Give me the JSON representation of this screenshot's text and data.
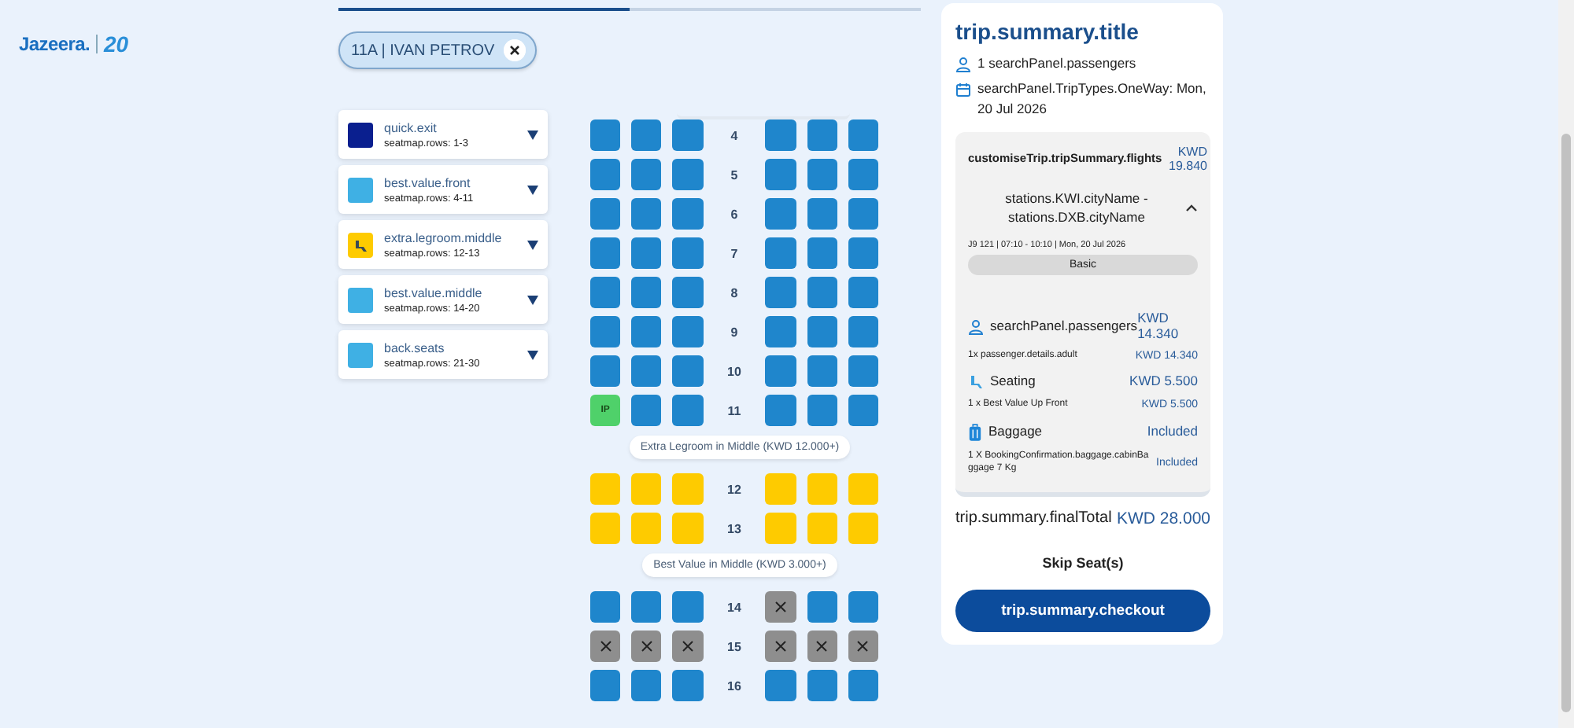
{
  "logo": {
    "brand": "Jazeera.",
    "anniversary": "20"
  },
  "tab_indicator": [
    {
      "selected": true
    },
    {
      "selected": false
    }
  ],
  "passenger_chip": {
    "label": "11A | IVAN PETROV"
  },
  "legend": [
    {
      "title": "quick.exit",
      "rows": "seatmap.rows: 1-3",
      "color": "#0a1f8f",
      "kind": "plain"
    },
    {
      "title": "best.value.front",
      "rows": "seatmap.rows: 4-11",
      "color": "#3fb0e4",
      "kind": "plain"
    },
    {
      "title": "extra.legroom.middle",
      "rows": "seatmap.rows: 12-13",
      "color": "#fecb00",
      "kind": "legroom"
    },
    {
      "title": "best.value.middle",
      "rows": "seatmap.rows: 14-20",
      "color": "#3fb0e4",
      "kind": "plain"
    },
    {
      "title": "back.seats",
      "rows": "seatmap.rows: 21-30",
      "color": "#3fb0e4",
      "kind": "plain"
    }
  ],
  "seat_map": {
    "sections": [
      {
        "rows": [
          {
            "number": "4",
            "seats": [
              {
                "kind": "available"
              },
              {
                "kind": "available"
              },
              {
                "kind": "available"
              },
              {
                "kind": "available"
              },
              {
                "kind": "available"
              },
              {
                "kind": "available"
              }
            ]
          },
          {
            "number": "5",
            "seats": [
              {
                "kind": "available"
              },
              {
                "kind": "available"
              },
              {
                "kind": "available"
              },
              {
                "kind": "available"
              },
              {
                "kind": "available"
              },
              {
                "kind": "available"
              }
            ]
          },
          {
            "number": "6",
            "seats": [
              {
                "kind": "available"
              },
              {
                "kind": "available"
              },
              {
                "kind": "available"
              },
              {
                "kind": "available"
              },
              {
                "kind": "available"
              },
              {
                "kind": "available"
              }
            ]
          },
          {
            "number": "7",
            "seats": [
              {
                "kind": "available"
              },
              {
                "kind": "available"
              },
              {
                "kind": "available"
              },
              {
                "kind": "available"
              },
              {
                "kind": "available"
              },
              {
                "kind": "available"
              }
            ]
          },
          {
            "number": "8",
            "seats": [
              {
                "kind": "available"
              },
              {
                "kind": "available"
              },
              {
                "kind": "available"
              },
              {
                "kind": "available"
              },
              {
                "kind": "available"
              },
              {
                "kind": "available"
              }
            ]
          },
          {
            "number": "9",
            "seats": [
              {
                "kind": "available"
              },
              {
                "kind": "available"
              },
              {
                "kind": "available"
              },
              {
                "kind": "available"
              },
              {
                "kind": "available"
              },
              {
                "kind": "available"
              }
            ]
          },
          {
            "number": "10",
            "seats": [
              {
                "kind": "available"
              },
              {
                "kind": "available"
              },
              {
                "kind": "available"
              },
              {
                "kind": "available"
              },
              {
                "kind": "available"
              },
              {
                "kind": "available"
              }
            ]
          },
          {
            "number": "11",
            "seats": [
              {
                "kind": "selected",
                "label": "IP"
              },
              {
                "kind": "available"
              },
              {
                "kind": "available"
              },
              {
                "kind": "available"
              },
              {
                "kind": "available"
              },
              {
                "kind": "available"
              }
            ]
          }
        ]
      },
      {
        "label": "Extra Legroom in Middle (KWD 12.000+)",
        "rows": [
          {
            "number": "12",
            "seats": [
              {
                "kind": "extra"
              },
              {
                "kind": "extra"
              },
              {
                "kind": "extra"
              },
              {
                "kind": "extra"
              },
              {
                "kind": "extra"
              },
              {
                "kind": "extra"
              }
            ]
          },
          {
            "number": "13",
            "seats": [
              {
                "kind": "extra"
              },
              {
                "kind": "extra"
              },
              {
                "kind": "extra"
              },
              {
                "kind": "extra"
              },
              {
                "kind": "extra"
              },
              {
                "kind": "extra"
              }
            ]
          }
        ]
      },
      {
        "label": "Best Value in Middle (KWD 3.000+)",
        "rows": [
          {
            "number": "14",
            "seats": [
              {
                "kind": "available"
              },
              {
                "kind": "available"
              },
              {
                "kind": "available"
              },
              {
                "kind": "occupied"
              },
              {
                "kind": "available"
              },
              {
                "kind": "available"
              }
            ]
          },
          {
            "number": "15",
            "seats": [
              {
                "kind": "occupied"
              },
              {
                "kind": "occupied"
              },
              {
                "kind": "occupied"
              },
              {
                "kind": "occupied"
              },
              {
                "kind": "occupied"
              },
              {
                "kind": "occupied"
              }
            ]
          },
          {
            "number": "16",
            "seats": [
              {
                "kind": "available"
              },
              {
                "kind": "available"
              },
              {
                "kind": "available"
              },
              {
                "kind": "available"
              },
              {
                "kind": "available"
              },
              {
                "kind": "available"
              }
            ]
          }
        ]
      }
    ]
  },
  "summary": {
    "title": "trip.summary.title",
    "passengers": "1 searchPanel.passengers",
    "date": "searchPanel.TripTypes.OneWay: Mon, 20 Jul 2026",
    "flight": {
      "heading": "customiseTrip.tripSummary.flights",
      "price": "KWD 19.840",
      "route": "stations.KWI.cityName - stations.DXB.cityName",
      "expanded": true,
      "details": "J9 121 | 07:10 - 10:10 | Mon, 20 Jul 2026",
      "fare": "Basic",
      "items": [
        {
          "kind": "passengers",
          "label": "searchPanel.passengers",
          "price": "KWD 14.340",
          "sub_label": "1x passenger.details.adult",
          "sub_price": "KWD 14.340"
        },
        {
          "kind": "seating",
          "label": "Seating",
          "price": "KWD 5.500",
          "sub_label": "1 x Best Value Up Front",
          "sub_price": "KWD 5.500"
        },
        {
          "kind": "baggage",
          "label": "Baggage",
          "price": "Included",
          "sub_label": "1 X BookingConfirmation.baggage.cabinBaggage 7 Kg",
          "sub_price": "Included"
        }
      ]
    },
    "total_label": "trip.summary.finalTotal",
    "total": "KWD 28.000",
    "skip": "Skip Seat(s)",
    "checkout": "trip.summary.checkout"
  }
}
